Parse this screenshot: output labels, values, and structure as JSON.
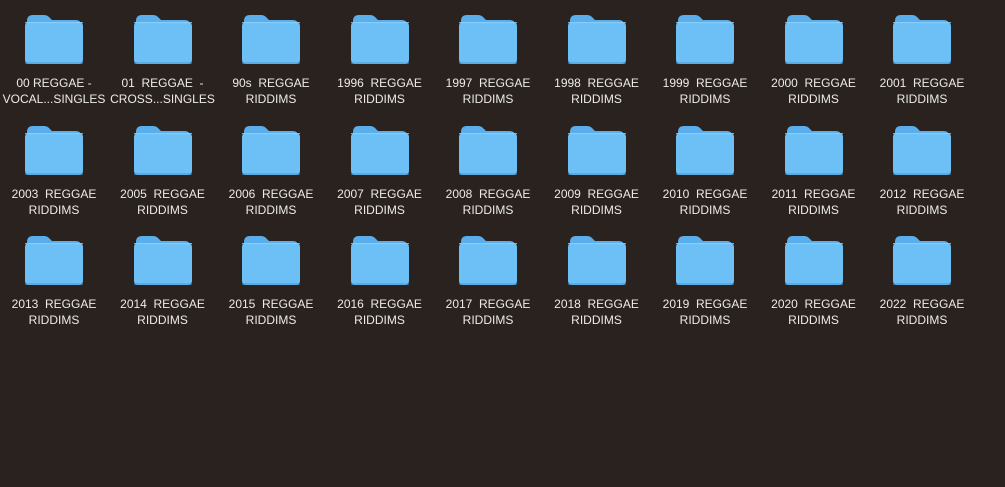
{
  "folders": [
    {
      "line1": "00 REGGAE -",
      "line2": "VOCAL...SINGLES"
    },
    {
      "line1": "01  REGGAE  -",
      "line2": "CROSS...SINGLES"
    },
    {
      "line1": "90s  REGGAE",
      "line2": "RIDDIMS"
    },
    {
      "line1": "1996  REGGAE",
      "line2": "RIDDIMS"
    },
    {
      "line1": "1997  REGGAE",
      "line2": "RIDDIMS"
    },
    {
      "line1": "1998  REGGAE",
      "line2": "RIDDIMS"
    },
    {
      "line1": "1999  REGGAE",
      "line2": "RIDDIMS"
    },
    {
      "line1": "2000  REGGAE",
      "line2": "RIDDIMS"
    },
    {
      "line1": "2001  REGGAE",
      "line2": "RIDDIMS"
    },
    {
      "line1": "2003  REGGAE",
      "line2": "RIDDIMS"
    },
    {
      "line1": "2005  REGGAE",
      "line2": "RIDDIMS"
    },
    {
      "line1": "2006  REGGAE",
      "line2": "RIDDIMS"
    },
    {
      "line1": "2007  REGGAE",
      "line2": "RIDDIMS"
    },
    {
      "line1": "2008  REGGAE",
      "line2": "RIDDIMS"
    },
    {
      "line1": "2009  REGGAE",
      "line2": "RIDDIMS"
    },
    {
      "line1": "2010  REGGAE",
      "line2": "RIDDIMS"
    },
    {
      "line1": "2011  REGGAE",
      "line2": "RIDDIMS"
    },
    {
      "line1": "2012  REGGAE",
      "line2": "RIDDIMS"
    },
    {
      "line1": "2013  REGGAE",
      "line2": "RIDDIMS"
    },
    {
      "line1": "2014  REGGAE",
      "line2": "RIDDIMS"
    },
    {
      "line1": "2015  REGGAE",
      "line2": "RIDDIMS"
    },
    {
      "line1": "2016  REGGAE",
      "line2": "RIDDIMS"
    },
    {
      "line1": "2017  REGGAE",
      "line2": "RIDDIMS"
    },
    {
      "line1": "2018  REGGAE",
      "line2": "RIDDIMS"
    },
    {
      "line1": "2019  REGGAE",
      "line2": "RIDDIMS"
    },
    {
      "line1": "2020  REGGAE",
      "line2": "RIDDIMS"
    },
    {
      "line1": "2022  REGGAE",
      "line2": "RIDDIMS"
    }
  ],
  "icons": {
    "folder": "folder-icon"
  },
  "colors": {
    "background": "#2a221f",
    "folder_front": "#6cc0f6",
    "folder_back": "#5aaeeb",
    "label_text": "#ecebe9"
  }
}
